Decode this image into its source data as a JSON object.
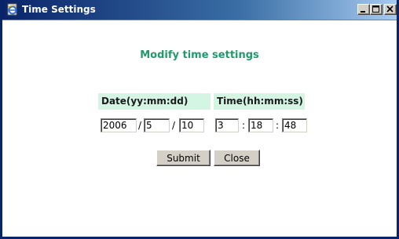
{
  "window": {
    "title": "Time Settings",
    "icon": "ie-page-icon",
    "titlebar_color": "#0a246a"
  },
  "form": {
    "heading": "Modify time settings",
    "heading_color": "#1f9a6a",
    "header_bg": "#d4f5e4",
    "date_header": "Date(yy:mm:dd)",
    "time_header": "Time(hh:mm:ss)",
    "date": {
      "year": "2006",
      "month": "5",
      "day": "10",
      "separator": "/"
    },
    "time": {
      "hour": "3",
      "minute": "18",
      "second": "48",
      "separator": ":"
    }
  },
  "buttons": {
    "submit_label": "Submit",
    "close_label": "Close"
  }
}
